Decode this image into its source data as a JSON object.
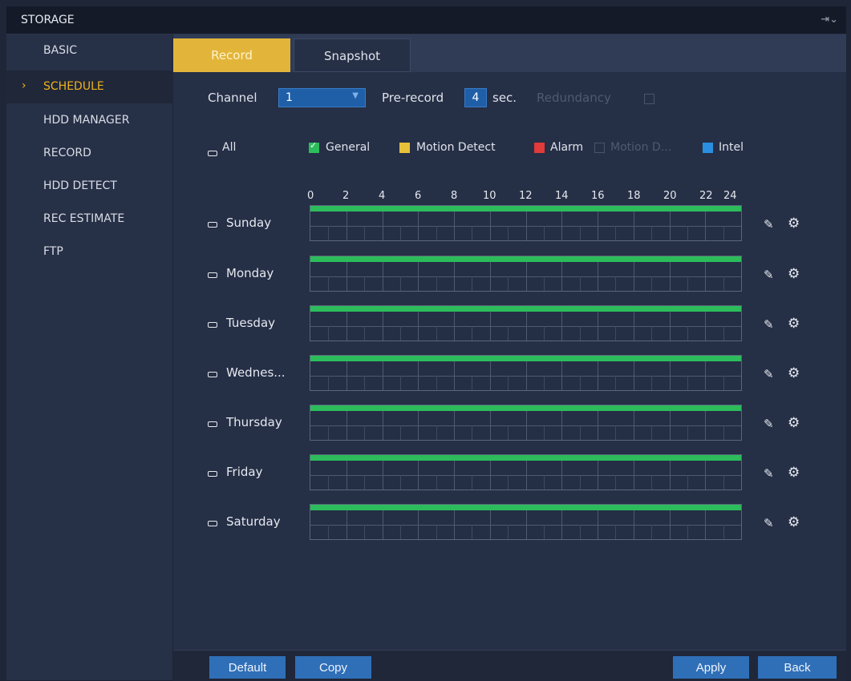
{
  "window": {
    "title": "STORAGE",
    "exit_icon": "exit-icon"
  },
  "sidebar": {
    "items": [
      {
        "label": "BASIC"
      },
      {
        "label": "SCHEDULE",
        "active": true
      },
      {
        "label": "HDD MANAGER"
      },
      {
        "label": "RECORD"
      },
      {
        "label": "HDD DETECT"
      },
      {
        "label": "REC ESTIMATE"
      },
      {
        "label": "FTP"
      }
    ],
    "active_arrow": "›"
  },
  "tabs": [
    {
      "label": "Record",
      "active": true
    },
    {
      "label": "Snapshot"
    }
  ],
  "form": {
    "channel_label": "Channel",
    "channel_value": "1",
    "prerecord_label": "Pre-record",
    "prerecord_value": "4",
    "prerecord_unit": "sec.",
    "redundancy_label": "Redundancy",
    "redundancy_checked": false
  },
  "legend": {
    "all_label": "All",
    "items": [
      {
        "label": "General",
        "color": "#2cbc5b",
        "checked": true
      },
      {
        "label": "Motion Detect",
        "color": "#e8c13a"
      },
      {
        "label": "Alarm",
        "color": "#e03a3a"
      },
      {
        "label": "Motion D...",
        "color": "none",
        "disabled": true
      },
      {
        "label": "Intel",
        "color": "#2a8fe0"
      }
    ]
  },
  "timeline": {
    "ticks": [
      "0",
      "2",
      "4",
      "6",
      "8",
      "10",
      "12",
      "14",
      "16",
      "18",
      "20",
      "22",
      "24"
    ]
  },
  "days": [
    {
      "label": "Sunday"
    },
    {
      "label": "Monday"
    },
    {
      "label": "Tuesday"
    },
    {
      "label": "Wednes..."
    },
    {
      "label": "Thursday"
    },
    {
      "label": "Friday"
    },
    {
      "label": "Saturday"
    }
  ],
  "schedule_color": "#2cbc5b",
  "footer": {
    "default_label": "Default",
    "copy_label": "Copy",
    "apply_label": "Apply",
    "back_label": "Back"
  }
}
